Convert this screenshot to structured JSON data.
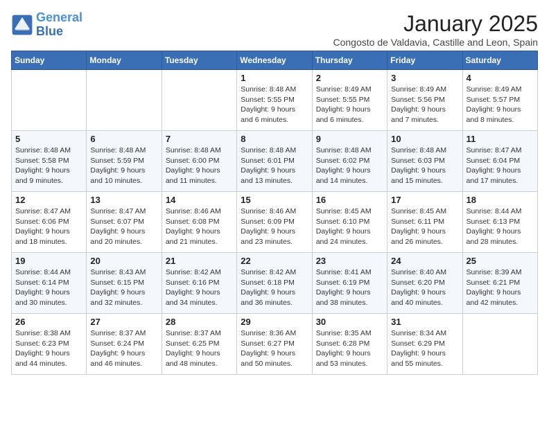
{
  "header": {
    "logo_line1": "General",
    "logo_line2": "Blue",
    "title": "January 2025",
    "subtitle": "Congosto de Valdavia, Castille and Leon, Spain"
  },
  "weekdays": [
    "Sunday",
    "Monday",
    "Tuesday",
    "Wednesday",
    "Thursday",
    "Friday",
    "Saturday"
  ],
  "weeks": [
    [
      {
        "day": "",
        "info": ""
      },
      {
        "day": "",
        "info": ""
      },
      {
        "day": "",
        "info": ""
      },
      {
        "day": "1",
        "info": "Sunrise: 8:48 AM\nSunset: 5:55 PM\nDaylight: 9 hours\nand 6 minutes."
      },
      {
        "day": "2",
        "info": "Sunrise: 8:49 AM\nSunset: 5:55 PM\nDaylight: 9 hours\nand 6 minutes."
      },
      {
        "day": "3",
        "info": "Sunrise: 8:49 AM\nSunset: 5:56 PM\nDaylight: 9 hours\nand 7 minutes."
      },
      {
        "day": "4",
        "info": "Sunrise: 8:49 AM\nSunset: 5:57 PM\nDaylight: 9 hours\nand 8 minutes."
      }
    ],
    [
      {
        "day": "5",
        "info": "Sunrise: 8:48 AM\nSunset: 5:58 PM\nDaylight: 9 hours\nand 9 minutes."
      },
      {
        "day": "6",
        "info": "Sunrise: 8:48 AM\nSunset: 5:59 PM\nDaylight: 9 hours\nand 10 minutes."
      },
      {
        "day": "7",
        "info": "Sunrise: 8:48 AM\nSunset: 6:00 PM\nDaylight: 9 hours\nand 11 minutes."
      },
      {
        "day": "8",
        "info": "Sunrise: 8:48 AM\nSunset: 6:01 PM\nDaylight: 9 hours\nand 13 minutes."
      },
      {
        "day": "9",
        "info": "Sunrise: 8:48 AM\nSunset: 6:02 PM\nDaylight: 9 hours\nand 14 minutes."
      },
      {
        "day": "10",
        "info": "Sunrise: 8:48 AM\nSunset: 6:03 PM\nDaylight: 9 hours\nand 15 minutes."
      },
      {
        "day": "11",
        "info": "Sunrise: 8:47 AM\nSunset: 6:04 PM\nDaylight: 9 hours\nand 17 minutes."
      }
    ],
    [
      {
        "day": "12",
        "info": "Sunrise: 8:47 AM\nSunset: 6:06 PM\nDaylight: 9 hours\nand 18 minutes."
      },
      {
        "day": "13",
        "info": "Sunrise: 8:47 AM\nSunset: 6:07 PM\nDaylight: 9 hours\nand 20 minutes."
      },
      {
        "day": "14",
        "info": "Sunrise: 8:46 AM\nSunset: 6:08 PM\nDaylight: 9 hours\nand 21 minutes."
      },
      {
        "day": "15",
        "info": "Sunrise: 8:46 AM\nSunset: 6:09 PM\nDaylight: 9 hours\nand 23 minutes."
      },
      {
        "day": "16",
        "info": "Sunrise: 8:45 AM\nSunset: 6:10 PM\nDaylight: 9 hours\nand 24 minutes."
      },
      {
        "day": "17",
        "info": "Sunrise: 8:45 AM\nSunset: 6:11 PM\nDaylight: 9 hours\nand 26 minutes."
      },
      {
        "day": "18",
        "info": "Sunrise: 8:44 AM\nSunset: 6:13 PM\nDaylight: 9 hours\nand 28 minutes."
      }
    ],
    [
      {
        "day": "19",
        "info": "Sunrise: 8:44 AM\nSunset: 6:14 PM\nDaylight: 9 hours\nand 30 minutes."
      },
      {
        "day": "20",
        "info": "Sunrise: 8:43 AM\nSunset: 6:15 PM\nDaylight: 9 hours\nand 32 minutes."
      },
      {
        "day": "21",
        "info": "Sunrise: 8:42 AM\nSunset: 6:16 PM\nDaylight: 9 hours\nand 34 minutes."
      },
      {
        "day": "22",
        "info": "Sunrise: 8:42 AM\nSunset: 6:18 PM\nDaylight: 9 hours\nand 36 minutes."
      },
      {
        "day": "23",
        "info": "Sunrise: 8:41 AM\nSunset: 6:19 PM\nDaylight: 9 hours\nand 38 minutes."
      },
      {
        "day": "24",
        "info": "Sunrise: 8:40 AM\nSunset: 6:20 PM\nDaylight: 9 hours\nand 40 minutes."
      },
      {
        "day": "25",
        "info": "Sunrise: 8:39 AM\nSunset: 6:21 PM\nDaylight: 9 hours\nand 42 minutes."
      }
    ],
    [
      {
        "day": "26",
        "info": "Sunrise: 8:38 AM\nSunset: 6:23 PM\nDaylight: 9 hours\nand 44 minutes."
      },
      {
        "day": "27",
        "info": "Sunrise: 8:37 AM\nSunset: 6:24 PM\nDaylight: 9 hours\nand 46 minutes."
      },
      {
        "day": "28",
        "info": "Sunrise: 8:37 AM\nSunset: 6:25 PM\nDaylight: 9 hours\nand 48 minutes."
      },
      {
        "day": "29",
        "info": "Sunrise: 8:36 AM\nSunset: 6:27 PM\nDaylight: 9 hours\nand 50 minutes."
      },
      {
        "day": "30",
        "info": "Sunrise: 8:35 AM\nSunset: 6:28 PM\nDaylight: 9 hours\nand 53 minutes."
      },
      {
        "day": "31",
        "info": "Sunrise: 8:34 AM\nSunset: 6:29 PM\nDaylight: 9 hours\nand 55 minutes."
      },
      {
        "day": "",
        "info": ""
      }
    ]
  ]
}
